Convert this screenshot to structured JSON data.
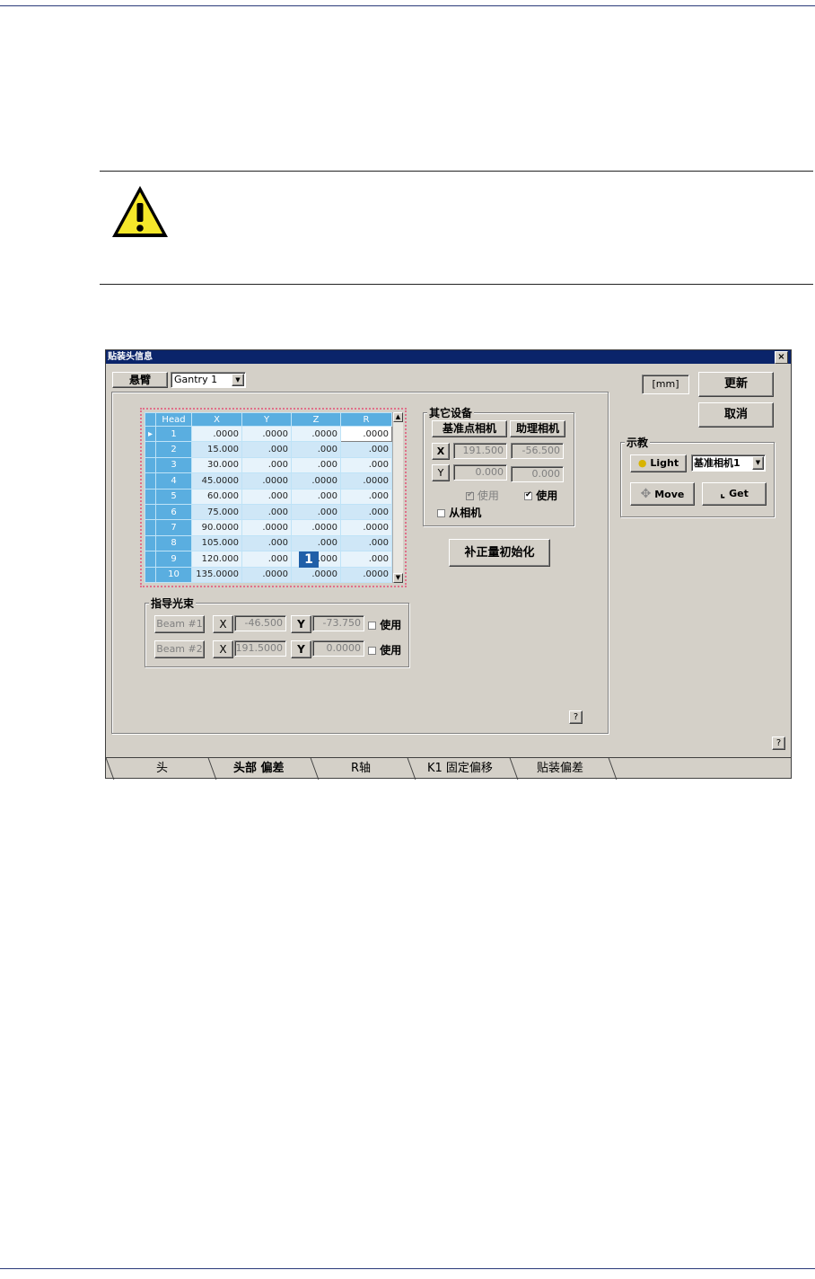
{
  "warning_icon": "warning-triangle-icon",
  "dialog": {
    "title": "贴装头信息",
    "close_label": "×",
    "gantry": {
      "label": "悬臂",
      "value": "Gantry 1"
    },
    "unit_label": "[mm]",
    "update_button": "更新",
    "cancel_button": "取消",
    "head_table": {
      "columns": [
        "Head",
        "X",
        "Y",
        "Z",
        "R"
      ],
      "rows": [
        [
          "1",
          ".0000",
          ".0000",
          ".0000",
          ".0000"
        ],
        [
          "2",
          "15.000",
          ".000",
          ".000",
          ".000"
        ],
        [
          "3",
          "30.000",
          ".000",
          ".000",
          ".000"
        ],
        [
          "4",
          "45.0000",
          ".0000",
          ".0000",
          ".0000"
        ],
        [
          "5",
          "60.000",
          ".000",
          ".000",
          ".000"
        ],
        [
          "6",
          "75.000",
          ".000",
          ".000",
          ".000"
        ],
        [
          "7",
          "90.0000",
          ".0000",
          ".0000",
          ".0000"
        ],
        [
          "8",
          "105.000",
          ".000",
          ".000",
          ".000"
        ],
        [
          "9",
          "120.000",
          ".000",
          ".000",
          ".000"
        ],
        [
          "10",
          "135.0000",
          ".0000",
          ".0000",
          ".0000"
        ]
      ],
      "callout": "1"
    },
    "other_devices": {
      "title": "其它设备",
      "col1": "基准点相机",
      "col2": "助理相机",
      "x_label": "X",
      "y_label": "Y",
      "x1": "191.500",
      "x2": "-56.500",
      "y1": "0.000",
      "y2": "0.000",
      "use1": "使用",
      "use2": "使用",
      "slave_camera": "从相机"
    },
    "init_button": "补正量初始化",
    "guide_beam": {
      "title": "指导光束",
      "beam1": {
        "name": "Beam #1",
        "x_label": "X",
        "x": "-46.500",
        "y_label": "Y",
        "y": "-73.750",
        "use": "使用"
      },
      "beam2": {
        "name": "Beam #2",
        "x_label": "X",
        "x": "191.5000",
        "y_label": "Y",
        "y": "0.0000",
        "use": "使用"
      }
    },
    "teach": {
      "title": "示教",
      "light_button": "Light",
      "camera_select": "基准相机1",
      "move_button": "Move",
      "get_button": "Get"
    },
    "help_label": "?",
    "tabs": [
      "头",
      "头部 偏差",
      "R轴",
      "K1 固定偏移",
      "贴装偏差"
    ]
  }
}
